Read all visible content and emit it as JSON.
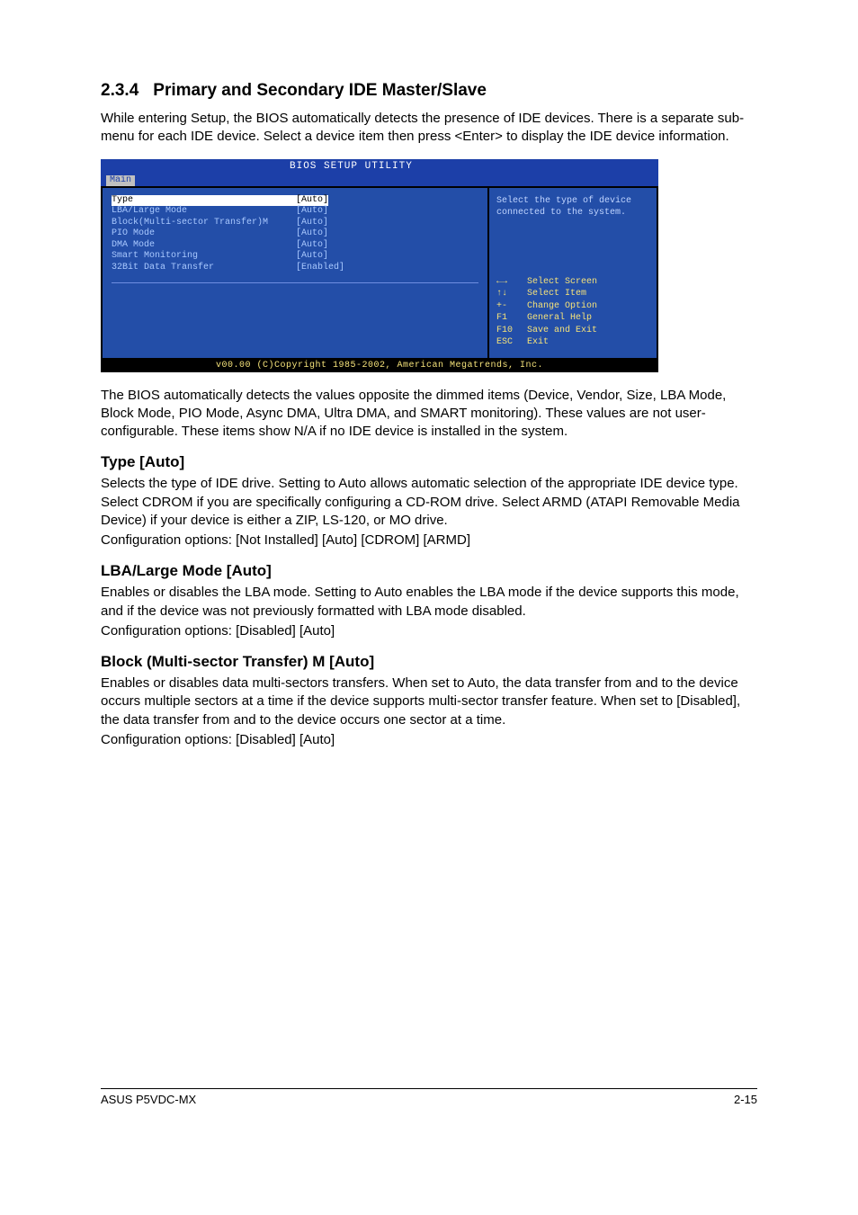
{
  "section": {
    "number": "2.3.4",
    "title": "Primary and Secondary IDE Master/Slave"
  },
  "intro": "While entering Setup, the BIOS automatically detects the presence of IDE devices. There is a separate sub-menu for each IDE device. Select a device item then press <Enter> to display the IDE device information.",
  "bios": {
    "bar_title": "BIOS SETUP UTILITY",
    "tab": "Main",
    "fields": [
      {
        "label": "Type",
        "value": "[Auto]",
        "selected": true
      },
      {
        "label": "LBA/Large Mode",
        "value": "[Auto]",
        "selected": false
      },
      {
        "label": "Block(Multi-sector Transfer)M",
        "value": "[Auto]",
        "selected": false
      },
      {
        "label": "PIO Mode",
        "value": "[Auto]",
        "selected": false
      },
      {
        "label": "DMA Mode",
        "value": "[Auto]",
        "selected": false
      },
      {
        "label": "Smart Monitoring",
        "value": "[Auto]",
        "selected": false
      },
      {
        "label": "32Bit Data Transfer",
        "value": "[Enabled]",
        "selected": false
      }
    ],
    "help": "Select the type of device connected to the system.",
    "keys": [
      {
        "key": "←→",
        "desc": "Select Screen"
      },
      {
        "key": "↑↓",
        "desc": "Select Item"
      },
      {
        "key": "+-",
        "desc": "Change Option"
      },
      {
        "key": "F1",
        "desc": "General Help"
      },
      {
        "key": "F10",
        "desc": "Save and Exit"
      },
      {
        "key": "ESC",
        "desc": "Exit"
      }
    ],
    "footer": "v00.00 (C)Copyright 1985-2002, American Megatrends, Inc."
  },
  "after_bios": "The BIOS automatically detects the values opposite the dimmed items (Device, Vendor, Size, LBA Mode, Block Mode, PIO Mode, Async DMA, Ultra DMA, and SMART monitoring). These values are not user-configurable. These items show N/A if no IDE device is installed in the system.",
  "type": {
    "heading": "Type [Auto]",
    "body": "Selects the type of IDE drive. Setting to Auto allows automatic selection of the appropriate IDE device type. Select CDROM if you are specifically configuring a CD-ROM drive. Select ARMD (ATAPI Removable Media Device) if your device is either a ZIP, LS-120, or MO drive.",
    "config": "Configuration options: [Not Installed] [Auto] [CDROM] [ARMD]"
  },
  "lba": {
    "heading": "LBA/Large Mode [Auto]",
    "body": "Enables or disables the LBA mode. Setting to Auto enables the LBA mode if the device supports this mode, and if the device was not previously formatted with LBA mode disabled.",
    "config": "Configuration options: [Disabled] [Auto]"
  },
  "block": {
    "heading": "Block (Multi-sector Transfer) M [Auto]",
    "body": "Enables or disables data multi-sectors transfers. When set to Auto, the data transfer from and to the device occurs multiple sectors at a time if the device supports multi-sector transfer feature. When set to [Disabled], the data transfer from and to the device occurs one sector at a time.",
    "config": "Configuration options: [Disabled] [Auto]"
  },
  "footer": {
    "left": "ASUS P5VDC-MX",
    "right": "2-15"
  }
}
